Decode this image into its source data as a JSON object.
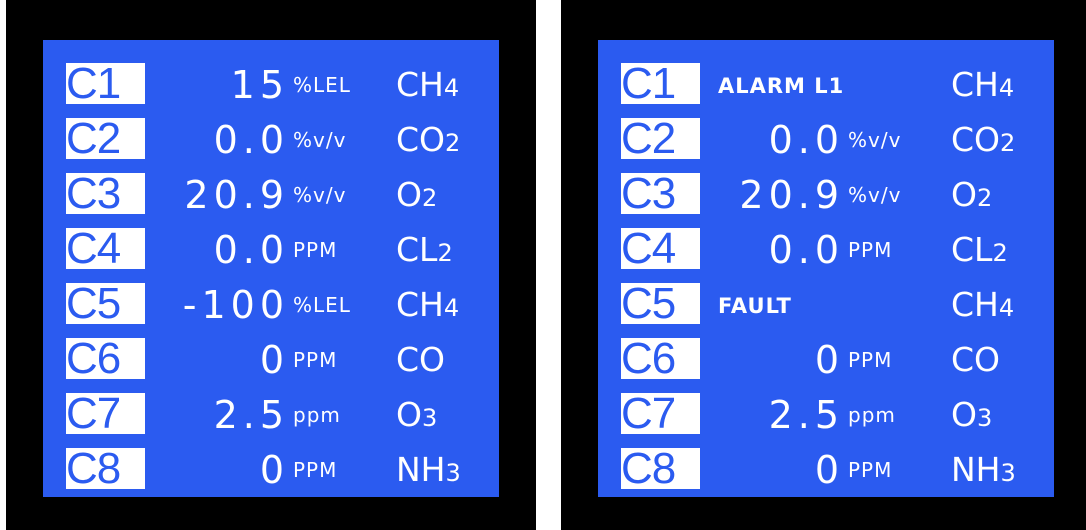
{
  "colors": {
    "screen_background": "#2b5bf0",
    "text": "#ffffff",
    "bezel": "#000000"
  },
  "panels": [
    {
      "rows": [
        {
          "channel": "C1",
          "value": "15",
          "unit": "%LEL",
          "gas": "CH",
          "gas_sub": "4"
        },
        {
          "channel": "C2",
          "value": "0.0",
          "unit": "%v/v",
          "gas": "CO",
          "gas_sub": "2"
        },
        {
          "channel": "C3",
          "value": "20.9",
          "unit": "%v/v",
          "gas": "O",
          "gas_sub": "2"
        },
        {
          "channel": "C4",
          "value": "0.0",
          "unit": "PPM",
          "gas": "CL",
          "gas_sub": "2"
        },
        {
          "channel": "C5",
          "value": "-100",
          "unit": "%LEL",
          "gas": "CH",
          "gas_sub": "4"
        },
        {
          "channel": "C6",
          "value": "0",
          "unit": "PPM",
          "gas": "CO",
          "gas_sub": ""
        },
        {
          "channel": "C7",
          "value": "2.5",
          "unit": "ppm",
          "gas": "O",
          "gas_sub": "3"
        },
        {
          "channel": "C8",
          "value": "0",
          "unit": "PPM",
          "gas": "NH",
          "gas_sub": "3"
        }
      ]
    },
    {
      "rows": [
        {
          "channel": "C1",
          "status": "ALARM L1",
          "gas": "CH",
          "gas_sub": "4"
        },
        {
          "channel": "C2",
          "value": "0.0",
          "unit": "%v/v",
          "gas": "CO",
          "gas_sub": "2"
        },
        {
          "channel": "C3",
          "value": "20.9",
          "unit": "%v/v",
          "gas": "O",
          "gas_sub": "2"
        },
        {
          "channel": "C4",
          "value": "0.0",
          "unit": "PPM",
          "gas": "CL",
          "gas_sub": "2"
        },
        {
          "channel": "C5",
          "status": "FAULT",
          "gas": "CH",
          "gas_sub": "4"
        },
        {
          "channel": "C6",
          "value": "0",
          "unit": "PPM",
          "gas": "CO",
          "gas_sub": ""
        },
        {
          "channel": "C7",
          "value": "2.5",
          "unit": "ppm",
          "gas": "O",
          "gas_sub": "3"
        },
        {
          "channel": "C8",
          "value": "0",
          "unit": "PPM",
          "gas": "NH",
          "gas_sub": "3"
        }
      ]
    }
  ]
}
